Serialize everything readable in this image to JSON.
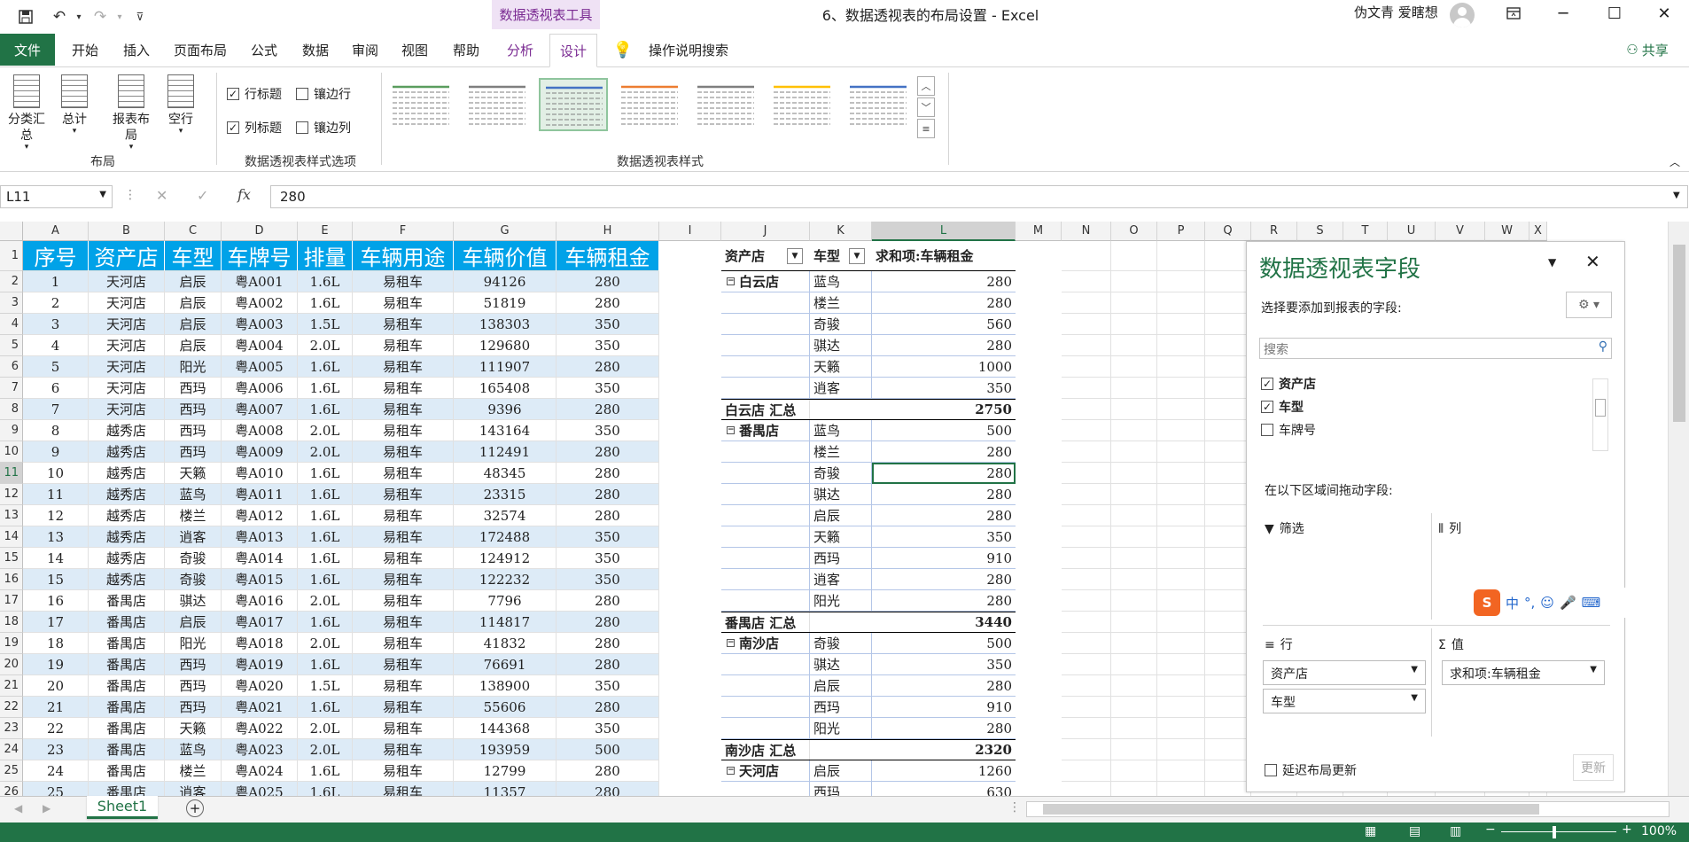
{
  "titlebar": {
    "context_tool": "数据透视表工具",
    "doc_title": "6、数据透视表的布局设置  -  Excel",
    "user": "伪文青 爱瞎想"
  },
  "tabs": [
    "文件",
    "开始",
    "插入",
    "页面布局",
    "公式",
    "数据",
    "审阅",
    "视图",
    "帮助",
    "分析",
    "设计"
  ],
  "tell_me": "操作说明搜索",
  "share": "共享",
  "ribbon": {
    "layout_buttons": [
      "分类汇\n总",
      "总计",
      "报表布\n局",
      "空行"
    ],
    "layout_group": "布局",
    "opt_row_headers": "行标题",
    "opt_col_headers": "列标题",
    "opt_banded_rows": "镶边行",
    "opt_banded_cols": "镶边列",
    "options_group": "数据透视表样式选项",
    "styles_group": "数据透视表样式",
    "colors": [
      "#5a9d5e",
      "#7f7f7f",
      "#4472c4",
      "#ed7d31",
      "#7f7f7f",
      "#ffc000",
      "#4472c4"
    ]
  },
  "formula_bar": {
    "name_box": "L11",
    "formula": "280"
  },
  "columns": [
    "A",
    "B",
    "C",
    "D",
    "E",
    "F",
    "G",
    "H",
    "I",
    "J",
    "K",
    "L",
    "M",
    "N",
    "O",
    "P",
    "Q",
    "R",
    "S",
    "T",
    "U",
    "V",
    "W",
    "X"
  ],
  "rows": [
    "1",
    "2",
    "3",
    "4",
    "5",
    "6",
    "7",
    "8",
    "9",
    "10",
    "11",
    "12",
    "13",
    "14",
    "15",
    "16",
    "17",
    "18",
    "19",
    "20",
    "21",
    "22",
    "23",
    "24",
    "25",
    "26"
  ],
  "table": {
    "headers": [
      "序号",
      "资产店",
      "车型",
      "车牌号",
      "排量",
      "车辆用途",
      "车辆价值",
      "车辆租金"
    ],
    "rows": [
      [
        "1",
        "天河店",
        "启辰",
        "粤A001",
        "1.6L",
        "易租车",
        "94126",
        "280"
      ],
      [
        "2",
        "天河店",
        "启辰",
        "粤A002",
        "1.6L",
        "易租车",
        "51819",
        "280"
      ],
      [
        "3",
        "天河店",
        "启辰",
        "粤A003",
        "1.5L",
        "易租车",
        "138303",
        "350"
      ],
      [
        "4",
        "天河店",
        "启辰",
        "粤A004",
        "2.0L",
        "易租车",
        "129680",
        "350"
      ],
      [
        "5",
        "天河店",
        "阳光",
        "粤A005",
        "1.6L",
        "易租车",
        "111907",
        "280"
      ],
      [
        "6",
        "天河店",
        "西玛",
        "粤A006",
        "1.6L",
        "易租车",
        "165408",
        "350"
      ],
      [
        "7",
        "天河店",
        "西玛",
        "粤A007",
        "1.6L",
        "易租车",
        "9396",
        "280"
      ],
      [
        "8",
        "越秀店",
        "西玛",
        "粤A008",
        "2.0L",
        "易租车",
        "143164",
        "350"
      ],
      [
        "9",
        "越秀店",
        "西玛",
        "粤A009",
        "2.0L",
        "易租车",
        "112491",
        "280"
      ],
      [
        "10",
        "越秀店",
        "天籁",
        "粤A010",
        "1.6L",
        "易租车",
        "48345",
        "280"
      ],
      [
        "11",
        "越秀店",
        "蓝鸟",
        "粤A011",
        "1.6L",
        "易租车",
        "23315",
        "280"
      ],
      [
        "12",
        "越秀店",
        "楼兰",
        "粤A012",
        "1.6L",
        "易租车",
        "32574",
        "280"
      ],
      [
        "13",
        "越秀店",
        "逍客",
        "粤A013",
        "1.6L",
        "易租车",
        "172488",
        "350"
      ],
      [
        "14",
        "越秀店",
        "奇骏",
        "粤A014",
        "1.6L",
        "易租车",
        "124912",
        "350"
      ],
      [
        "15",
        "越秀店",
        "奇骏",
        "粤A015",
        "1.6L",
        "易租车",
        "122232",
        "350"
      ],
      [
        "16",
        "番禺店",
        "骐达",
        "粤A016",
        "2.0L",
        "易租车",
        "7796",
        "280"
      ],
      [
        "17",
        "番禺店",
        "启辰",
        "粤A017",
        "1.6L",
        "易租车",
        "114817",
        "280"
      ],
      [
        "18",
        "番禺店",
        "阳光",
        "粤A018",
        "2.0L",
        "易租车",
        "41832",
        "280"
      ],
      [
        "19",
        "番禺店",
        "西玛",
        "粤A019",
        "1.6L",
        "易租车",
        "76691",
        "280"
      ],
      [
        "20",
        "番禺店",
        "西玛",
        "粤A020",
        "1.5L",
        "易租车",
        "138900",
        "350"
      ],
      [
        "21",
        "番禺店",
        "西玛",
        "粤A021",
        "1.6L",
        "易租车",
        "55606",
        "280"
      ],
      [
        "22",
        "番禺店",
        "天籁",
        "粤A022",
        "2.0L",
        "易租车",
        "144368",
        "350"
      ],
      [
        "23",
        "番禺店",
        "蓝鸟",
        "粤A023",
        "2.0L",
        "易租车",
        "193959",
        "500"
      ],
      [
        "24",
        "番禺店",
        "楼兰",
        "粤A024",
        "1.6L",
        "易租车",
        "12799",
        "280"
      ],
      [
        "25",
        "番禺店",
        "逍客",
        "粤A025",
        "1.6L",
        "易租车",
        "11357",
        "280"
      ]
    ]
  },
  "pivot": {
    "headers": [
      "资产店",
      "车型",
      "求和项:车辆租金"
    ],
    "rows": [
      [
        "白云店",
        "蓝鸟",
        "280"
      ],
      [
        "",
        "楼兰",
        "280"
      ],
      [
        "",
        "奇骏",
        "560"
      ],
      [
        "",
        "骐达",
        "280"
      ],
      [
        "",
        "天籁",
        "1000"
      ],
      [
        "",
        "逍客",
        "350"
      ],
      [
        "白云店 汇总",
        "",
        "2750"
      ],
      [
        "番禺店",
        "蓝鸟",
        "500"
      ],
      [
        "",
        "楼兰",
        "280"
      ],
      [
        "",
        "奇骏",
        "280"
      ],
      [
        "",
        "骐达",
        "280"
      ],
      [
        "",
        "启辰",
        "280"
      ],
      [
        "",
        "天籁",
        "350"
      ],
      [
        "",
        "西玛",
        "910"
      ],
      [
        "",
        "逍客",
        "280"
      ],
      [
        "",
        "阳光",
        "280"
      ],
      [
        "番禺店 汇总",
        "",
        "3440"
      ],
      [
        "南沙店",
        "奇骏",
        "500"
      ],
      [
        "",
        "骐达",
        "350"
      ],
      [
        "",
        "启辰",
        "280"
      ],
      [
        "",
        "西玛",
        "910"
      ],
      [
        "",
        "阳光",
        "280"
      ],
      [
        "南沙店 汇总",
        "",
        "2320"
      ],
      [
        "天河店",
        "启辰",
        "1260"
      ],
      [
        "",
        "西玛",
        "630"
      ]
    ]
  },
  "field_pane": {
    "title": "数据透视表字段",
    "subtitle": "选择要添加到报表的字段:",
    "search_placeholder": "搜索",
    "fields": [
      {
        "label": "资产店",
        "checked": true
      },
      {
        "label": "车型",
        "checked": true
      },
      {
        "label": "车牌号",
        "checked": false
      }
    ],
    "drag_hint": "在以下区域间拖动字段:",
    "filter_label": "筛选",
    "columns_label": "列",
    "rows_label": "行",
    "values_label": "值",
    "row_items": [
      "资产店",
      "车型"
    ],
    "value_items": [
      "求和项:车辆租金"
    ],
    "defer_label": "延迟布局更新",
    "update_label": "更新",
    "ime_label": "中"
  },
  "sheet_tab": "Sheet1",
  "status": {
    "zoom": "100%"
  }
}
